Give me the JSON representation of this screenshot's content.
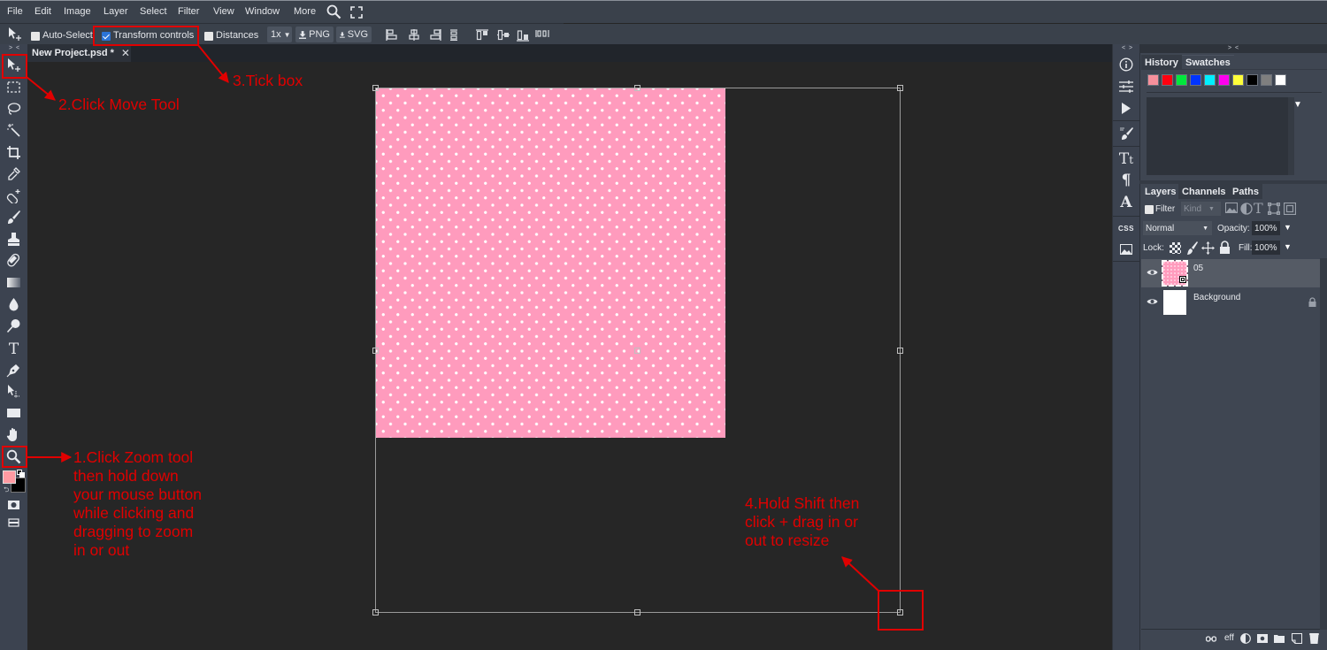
{
  "menu": {
    "items": [
      "File",
      "Edit",
      "Image",
      "Layer",
      "Select",
      "Filter",
      "View",
      "Window",
      "More"
    ],
    "search_icon": "search-icon",
    "fullscreen_icon": "fullscreen-icon"
  },
  "options": {
    "auto_select_label": "Auto-Select",
    "auto_select_checked": false,
    "transform_controls_label": "Transform controls",
    "transform_controls_checked": true,
    "distances_label": "Distances",
    "distances_checked": false,
    "scale_value": "1x",
    "png_label": "PNG",
    "svg_label": "SVG",
    "align_icons": [
      "align-left-icon",
      "align-center-h-icon",
      "align-right-icon",
      "distribute-h-icon",
      "align-top-icon",
      "align-middle-v-icon",
      "align-bottom-icon",
      "distribute-v-icon"
    ]
  },
  "document_tab": {
    "title": "New Project.psd *",
    "close": "✕"
  },
  "tools": [
    "move",
    "marquee",
    "lasso",
    "magic-wand",
    "crop",
    "eyedropper",
    "healing",
    "brush",
    "clone-stamp",
    "eraser",
    "gradient",
    "blur",
    "dodge",
    "text",
    "pen",
    "path-select",
    "rectangle",
    "hand",
    "zoom"
  ],
  "colors": {
    "foreground": "#ff9aa2",
    "background": "#000000",
    "pattern_color": "#ff9bbd"
  },
  "right_icons": [
    "info-icon",
    "adjustments-icon",
    "actions-play-icon",
    "brush-settings-icon",
    "character-icon",
    "paragraph-icon",
    "glyphs-icon",
    "css-icon",
    "image-icon"
  ],
  "right_icons_css_label": "CSS",
  "history_panel": {
    "tabs": [
      "History",
      "Swatches"
    ],
    "active_tab": "Swatches",
    "swatches": [
      "#f7909c",
      "#ff0010",
      "#00e83c",
      "#0034ff",
      "#00f0ff",
      "#ff00ee",
      "#ffff3a",
      "#000000",
      "#7f7f7f",
      "#ffffff"
    ]
  },
  "layers_panel": {
    "tabs": [
      "Layers",
      "Channels",
      "Paths"
    ],
    "active_tab": "Layers",
    "filter_label": "Filter",
    "kind_placeholder": "Kind",
    "blend_mode": "Normal",
    "opacity_label": "Opacity:",
    "opacity_value": "100%",
    "lock_label": "Lock:",
    "fill_label": "Fill:",
    "fill_value": "100%",
    "layers": [
      {
        "name": "05",
        "selected": true,
        "visible": true,
        "locked": false
      },
      {
        "name": "Background",
        "selected": false,
        "visible": true,
        "locked": true
      }
    ],
    "bottom_icons": [
      "link-icon",
      "effects-icon",
      "adjustment-layer-icon",
      "mask-icon",
      "folder-icon",
      "new-layer-icon",
      "trash-icon"
    ],
    "effects_label": "eff"
  },
  "annotations": {
    "step1": [
      "1.Click Zoom tool",
      "then hold down",
      "your mouse button",
      "while clicking and",
      "dragging to zoom",
      "in or out"
    ],
    "step2": "2.Click Move Tool",
    "step3": "3.Tick box",
    "step4": [
      "4.Hold Shift then",
      "click + drag in or",
      "out to resize"
    ],
    "color": "#e00000"
  }
}
